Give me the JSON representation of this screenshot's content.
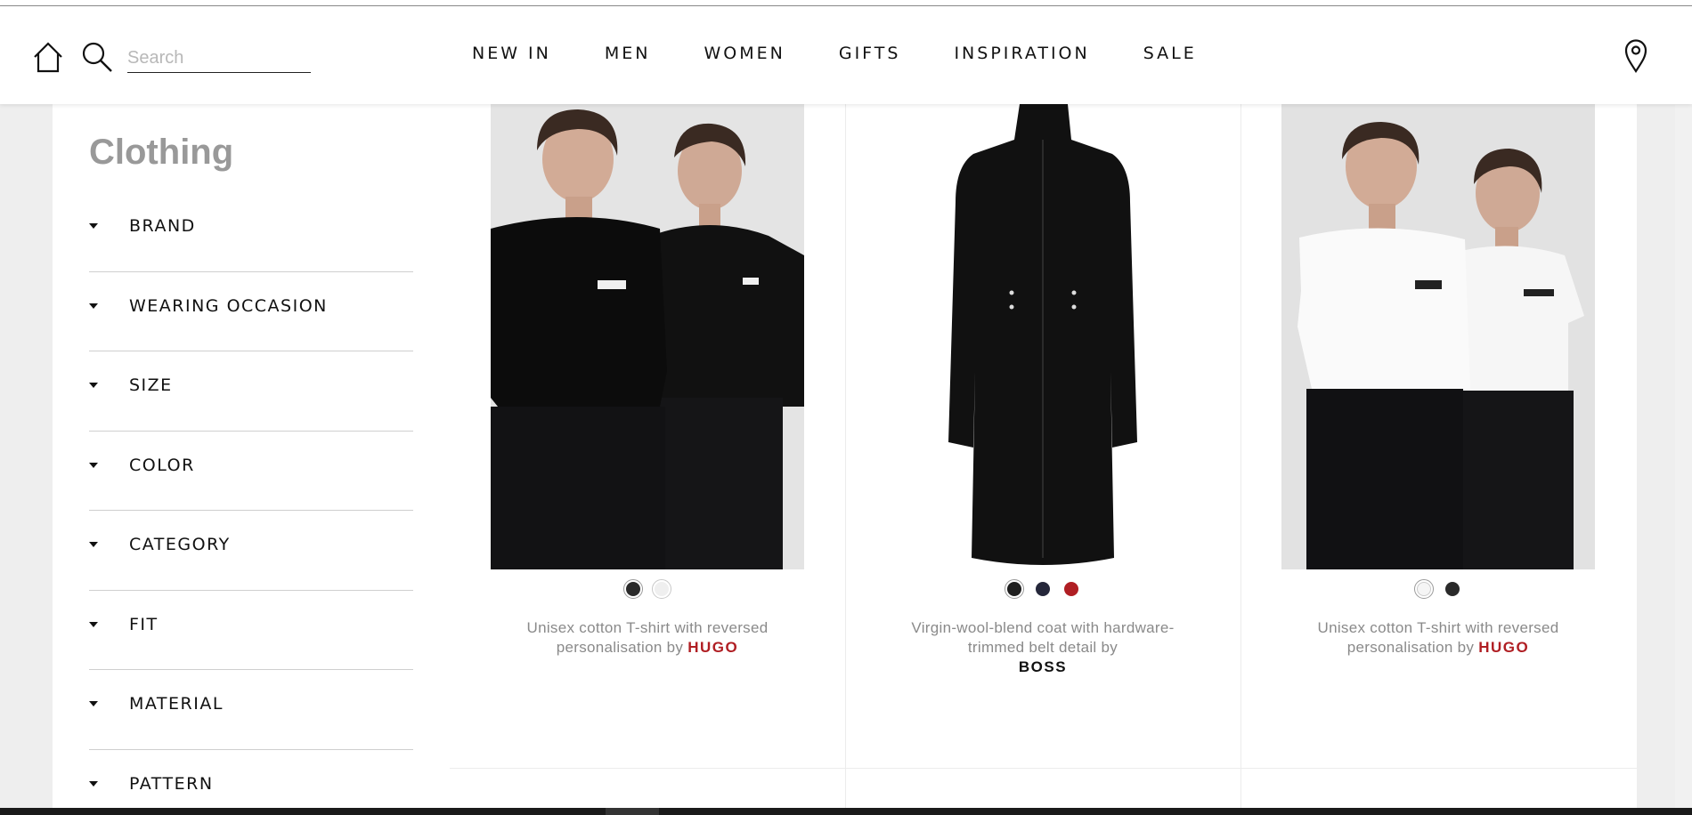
{
  "header": {
    "search": {
      "placeholder": "Search",
      "value": ""
    },
    "nav": [
      "NEW IN",
      "MEN",
      "WOMEN",
      "GIFTS",
      "INSPIRATION",
      "SALE"
    ]
  },
  "sidebar": {
    "title": "Clothing",
    "filters": [
      "BRAND",
      "WEARING OCCASION",
      "SIZE",
      "COLOR",
      "CATEGORY",
      "FIT",
      "MATERIAL",
      "PATTERN"
    ]
  },
  "products": [
    {
      "image": "two models wearing black t-shirts and black jeans",
      "swatches": [
        "#2a2a2a",
        "#efefef"
      ],
      "description": "Unisex cotton T-shirt with reversed personalisation by",
      "brand": "HUGO",
      "brand_color": "#b01e23"
    },
    {
      "image": "black long wool coat",
      "swatches": [
        "#1f1f1f",
        "#25273a",
        "#b01e23"
      ],
      "description": "Virgin-wool-blend coat with hardware-trimmed belt detail by",
      "brand": "BOSS",
      "brand_color": "#111111"
    },
    {
      "image": "two models wearing white t-shirts and black jeans",
      "swatches": [
        "#f5f5f5",
        "#2a2a2a"
      ],
      "description": "Unisex cotton T-shirt with reversed personalisation by",
      "brand": "HUGO",
      "brand_color": "#b01e23"
    }
  ],
  "colors": {
    "accent": "#b01e23",
    "background": "#eeeeee"
  }
}
